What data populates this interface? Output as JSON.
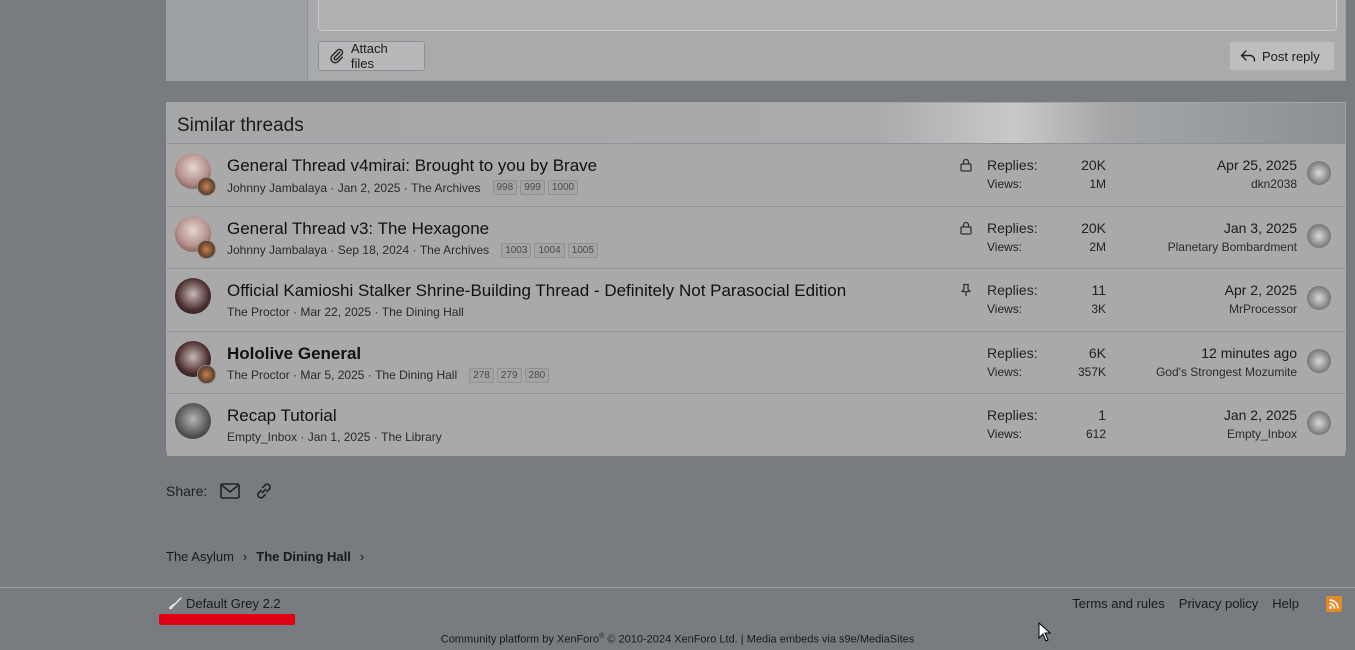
{
  "reply": {
    "attach_label": "Attach files",
    "post_label": "Post reply"
  },
  "similar": {
    "heading": "Similar threads",
    "threads": [
      {
        "title": "General Thread v4mirai: Brought to you by Brave",
        "author": "Johnny Jambalaya",
        "date": "Jan 2, 2025",
        "forum": "The Archives",
        "pages": [
          "998",
          "999",
          "1000"
        ],
        "status": "lock-icon",
        "replies": "20K",
        "views": "1M",
        "last_date": "Apr 25, 2025",
        "last_user": "dkn2038",
        "bold": false
      },
      {
        "title": "General Thread v3: The Hexagone",
        "author": "Johnny Jambalaya",
        "date": "Sep 18, 2024",
        "forum": "The Archives",
        "pages": [
          "1003",
          "1004",
          "1005"
        ],
        "status": "lock-icon",
        "replies": "20K",
        "views": "2M",
        "last_date": "Jan 3, 2025",
        "last_user": "Planetary Bombardment",
        "bold": false
      },
      {
        "title": "Official Kamioshi Stalker Shrine-Building Thread - Definitely Not Parasocial Edition",
        "author": "The Proctor",
        "date": "Mar 22, 2025",
        "forum": "The Dining Hall",
        "pages": [],
        "status": "pin-icon",
        "replies": "11",
        "views": "3K",
        "last_date": "Apr 2, 2025",
        "last_user": "MrProcessor",
        "bold": false
      },
      {
        "title": "Hololive General",
        "author": "The Proctor",
        "date": "Mar 5, 2025",
        "forum": "The Dining Hall",
        "pages": [
          "278",
          "279",
          "280"
        ],
        "status": "",
        "replies": "6K",
        "views": "357K",
        "last_date": "12 minutes ago",
        "last_user": "God's Strongest Mozumite",
        "bold": true
      },
      {
        "title": "Recap Tutorial",
        "author": "Empty_Inbox",
        "date": "Jan 1, 2025",
        "forum": "The Library",
        "pages": [],
        "status": "",
        "replies": "1",
        "views": "612",
        "last_date": "Jan 2, 2025",
        "last_user": "Empty_Inbox",
        "bold": false
      }
    ],
    "replies_label": "Replies:",
    "views_label": "Views:"
  },
  "share": {
    "label": "Share:"
  },
  "breadcrumb": {
    "items": [
      "The Asylum",
      "The Dining Hall"
    ]
  },
  "footer": {
    "style_name": "Default Grey 2.2",
    "links": [
      "Terms and rules",
      "Privacy policy",
      "Help"
    ],
    "copyright_a": "Community platform by XenForo",
    "copyright_reg": "®",
    "copyright_b": " © 2010-2024 XenForo Ltd. | Media embeds via s9e/MediaSites"
  }
}
